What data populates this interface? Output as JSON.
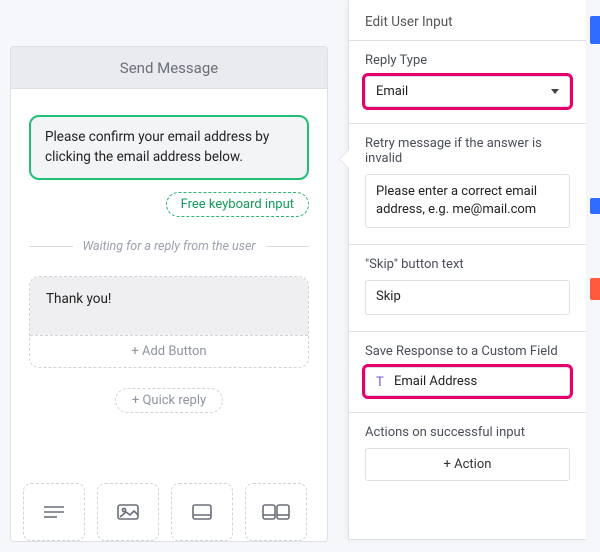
{
  "preview": {
    "title": "Send Message",
    "bubble_text": "Please confirm your email address by clicking the email address below.",
    "free_input_label": "Free keyboard input",
    "waiting_label": "Waiting for a reply from the user",
    "reply_text": "Thank you!",
    "add_button_label": "+ Add Button",
    "quick_reply_label": "+ Quick reply"
  },
  "panel": {
    "title": "Edit User Input",
    "reply_type_label": "Reply Type",
    "reply_type_value": "Email",
    "retry_label": "Retry message if the answer is invalid",
    "retry_value": "Please enter a correct email address, e.g. me@mail.com",
    "skip_label": "\"Skip\" button text",
    "skip_value": "Skip",
    "save_label": "Save Response to a Custom Field",
    "save_field": "Email Address",
    "actions_label": "Actions on successful input",
    "actions_button": "+ Action"
  }
}
